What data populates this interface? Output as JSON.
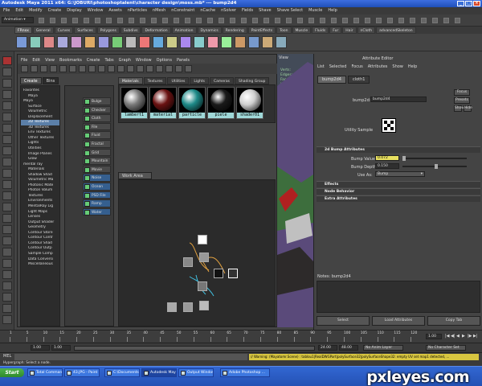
{
  "titlebar": {
    "title": "Autodesk Maya 2011 x64: G:\\JOBURI\\photoshoptalent\\character design\\moss.mb* --- bump2d4"
  },
  "menubar": [
    "File",
    "Edit",
    "Modify",
    "Create",
    "Display",
    "Window",
    "Assets",
    "nParticles",
    "nMesh",
    "nConstraint",
    "nCache",
    "nSolver",
    "Fields",
    "Shave",
    "Shave Select",
    "Muscle",
    "Help"
  ],
  "statusline": {
    "mode": "Animation"
  },
  "shelf_tabs": [
    "FRnxx",
    "General",
    "Curves",
    "Surfaces",
    "Polygons",
    "Subdivs",
    "Deformation",
    "Animation",
    "Dynamics",
    "Rendering",
    "PaintEffects",
    "Toon",
    "Muscle",
    "Fluids",
    "Fur",
    "Hair",
    "nCloth",
    "advancedSkeleton"
  ],
  "hypershade": {
    "menus": [
      "File",
      "Edit",
      "View",
      "Bookmarks",
      "Create",
      "Tabs",
      "Graph",
      "Window",
      "Options",
      "Panels"
    ],
    "create_tabs": [
      "Create",
      "Bins"
    ],
    "tree": [
      {
        "label": "Favorites",
        "top": true
      },
      {
        "label": "Maya"
      },
      {
        "label": "Maya",
        "top": true
      },
      {
        "label": "Surface"
      },
      {
        "label": "Volumetric"
      },
      {
        "label": "Displacement"
      },
      {
        "label": "2D Textures",
        "sel": true
      },
      {
        "label": "3D Textures"
      },
      {
        "label": "Env Textures"
      },
      {
        "label": "Other Textures"
      },
      {
        "label": "Lights"
      },
      {
        "label": "Utilities"
      },
      {
        "label": "Image Planes"
      },
      {
        "label": "Glow"
      },
      {
        "label": "mental ray",
        "top": true
      },
      {
        "label": "Materials"
      },
      {
        "label": "Shadow Shad"
      },
      {
        "label": "Volumetric Ma"
      },
      {
        "label": "Photonic Mate"
      },
      {
        "label": "Photon Volum"
      },
      {
        "label": "Textures"
      },
      {
        "label": "Environments"
      },
      {
        "label": "MentalRay Lig"
      },
      {
        "label": "Light Maps"
      },
      {
        "label": "Lenses"
      },
      {
        "label": "Output Shader"
      },
      {
        "label": "Geometry"
      },
      {
        "label": "Contour Store"
      },
      {
        "label": "Contour Contr"
      },
      {
        "label": "Contour Shad"
      },
      {
        "label": "Contour Outp"
      },
      {
        "label": "Sample Comp"
      },
      {
        "label": "Data Conversi"
      },
      {
        "label": "Miscellaneous"
      }
    ],
    "nodes": [
      "Bulge",
      "Checker",
      "Cloth",
      "File",
      "Fluid Textu",
      "Fractal",
      "Grid",
      "Mountain",
      "Movie",
      "Noise",
      "Ocean",
      "PSD File",
      "Ramp",
      "Water"
    ],
    "material_tabs": [
      "Materials",
      "Textures",
      "Utilities",
      "Lights",
      "Cameras",
      "Shading Group"
    ],
    "swatches": [
      {
        "label": "lambert1",
        "color": "#7a7a7a"
      },
      {
        "label": "material",
        "color": "#6a1212"
      },
      {
        "label": "particle",
        "color": "#1e8a88"
      },
      {
        "label": "piele",
        "color": "#1a1a1a"
      },
      {
        "label": "shader01",
        "color": "#cfcfcf"
      }
    ],
    "work_area_tab": "Work Area"
  },
  "viewport": {
    "hud": [
      "Verts:",
      "Edges:",
      "Faces:",
      "UVs:"
    ],
    "vals": [
      "",
      "",
      "",
      "",
      "",
      "100%"
    ],
    "panel_menus": [
      "View"
    ]
  },
  "attr_editor": {
    "title": "Attribute Editor",
    "menus": [
      "List",
      "Selected",
      "Focus",
      "Attributes",
      "Show",
      "Help"
    ],
    "tabs": [
      "bump2d4",
      "cloth1"
    ],
    "type_label": "bump2d:",
    "node_name": "bump2d4",
    "focus": "Focus",
    "presets": "Presets",
    "show": "Show",
    "hide": "Hide",
    "sample_label": "Utility Sample",
    "sections": [
      "2d Bump Attributes",
      "Effects",
      "Node Behavior",
      "Extra Attributes"
    ],
    "bump_value_label": "Bump Value",
    "bump_value": "0.072",
    "bump_depth_label": "Bump Depth",
    "bump_depth": "0.150",
    "use_as_label": "Use As:",
    "use_as": "Bump",
    "notes_label": "Notes: bump2d4",
    "buttons": [
      "Select",
      "Load Attributes",
      "Copy Tab"
    ]
  },
  "timeline": {
    "ticks": [
      "1",
      "5",
      "10",
      "15",
      "20",
      "25",
      "30",
      "35",
      "40",
      "45",
      "50",
      "55",
      "60",
      "65",
      "70",
      "75",
      "80",
      "85",
      "90",
      "95",
      "100",
      "105",
      "110",
      "115",
      "120"
    ],
    "current": "1.00"
  },
  "range": {
    "start": "1.00",
    "start2": "1.00",
    "end": "24.00",
    "end2": "48.00",
    "anim_layer": "No Anim Layer",
    "char_set": "No Character Set"
  },
  "cmdline": {
    "label": "MEL",
    "warning": "// Warning: (Mayatomr.Scene) : tablou1|RealDWGPart|polySurface32|polySurfaceShape32: empty UV set map1 detected, ..."
  },
  "helpline": "Hypergraph: Select a node.",
  "taskbar": {
    "start": "Start",
    "items": [
      "Total Commander ...",
      "43.JPG - Paint",
      "C:\\Documents and Settin...",
      "Autodesk Maya 2011...",
      "Output Window",
      "Adobe Photoshop ..."
    ]
  },
  "watermark": "pxleyes.com"
}
